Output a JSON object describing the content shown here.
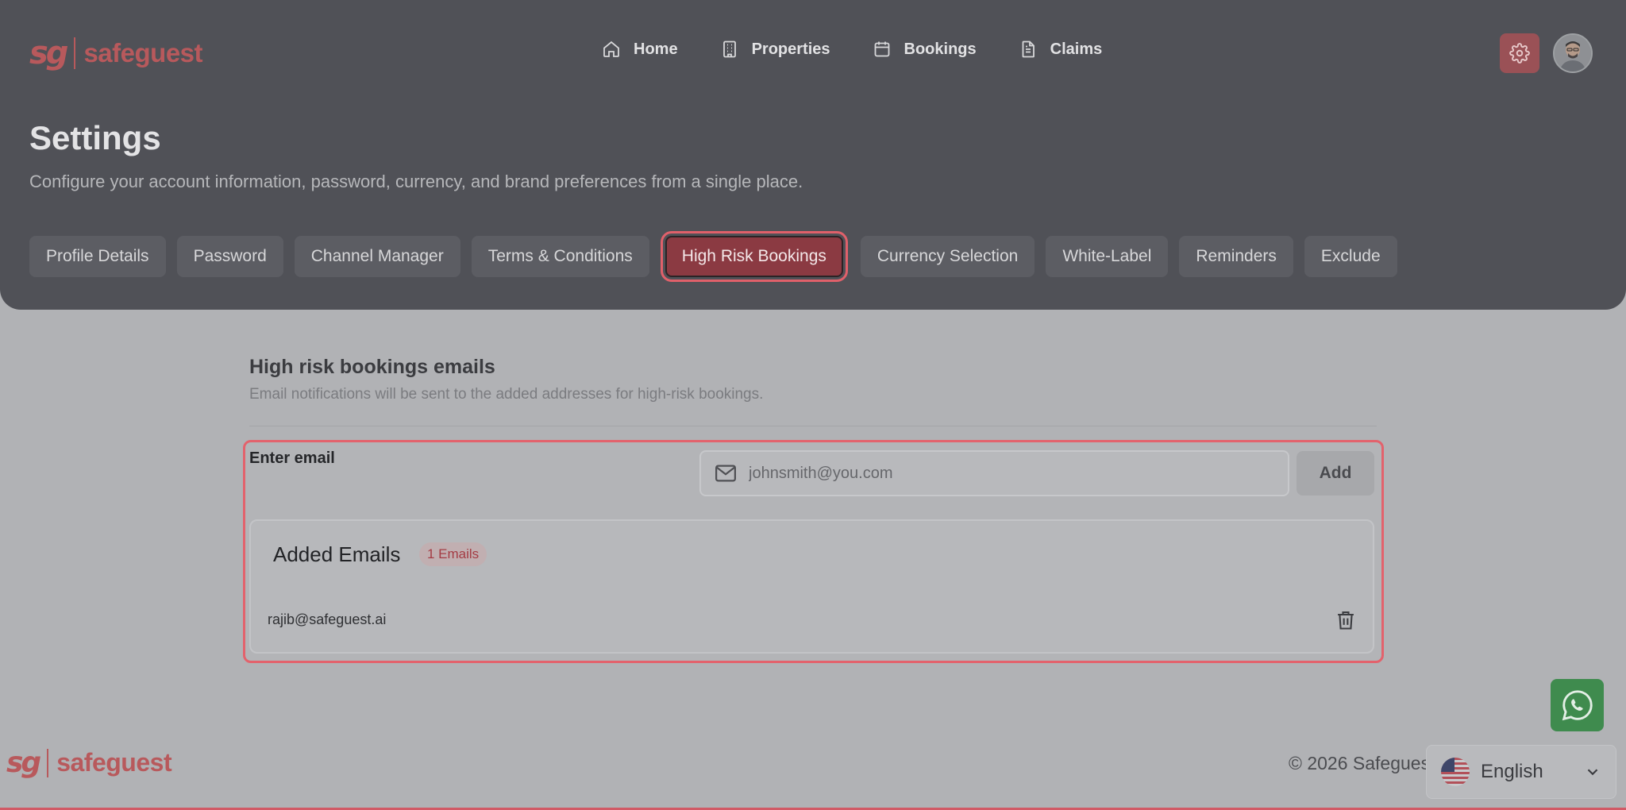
{
  "brand": {
    "mark": "sg",
    "name": "safeguest",
    "accent_color": "#b8595c"
  },
  "nav": {
    "items": [
      {
        "label": "Home",
        "icon": "home-icon"
      },
      {
        "label": "Properties",
        "icon": "building-icon"
      },
      {
        "label": "Bookings",
        "icon": "calendar-icon"
      },
      {
        "label": "Claims",
        "icon": "document-icon"
      }
    ]
  },
  "header": {
    "title": "Settings",
    "subtitle": "Configure your account information, password, currency, and brand preferences from a single place."
  },
  "tabs": [
    {
      "label": "Profile Details",
      "active": false
    },
    {
      "label": "Password",
      "active": false
    },
    {
      "label": "Channel Manager",
      "active": false
    },
    {
      "label": "Terms & Conditions",
      "active": false
    },
    {
      "label": "High Risk Bookings",
      "active": true
    },
    {
      "label": "Currency Selection",
      "active": false
    },
    {
      "label": "White-Label",
      "active": false
    },
    {
      "label": "Reminders",
      "active": false
    },
    {
      "label": "Exclude",
      "active": false
    }
  ],
  "section": {
    "title": "High risk bookings emails",
    "description": "Email notifications will be sent to the added addresses for high-risk bookings."
  },
  "email_form": {
    "label": "Enter email",
    "placeholder": "johnsmith@you.com",
    "value": "",
    "add_label": "Add"
  },
  "added_emails": {
    "title": "Added Emails",
    "count_badge": "1 Emails",
    "items": [
      {
        "email": "rajib@safeguest.ai"
      }
    ]
  },
  "footer": {
    "copyright": "© 2026 Safeguest",
    "language": "English"
  },
  "colors": {
    "header_bg": "#505157",
    "active_tab": "#8b3a42",
    "highlight_border": "#e3626c",
    "whatsapp": "#3f8b4e"
  }
}
